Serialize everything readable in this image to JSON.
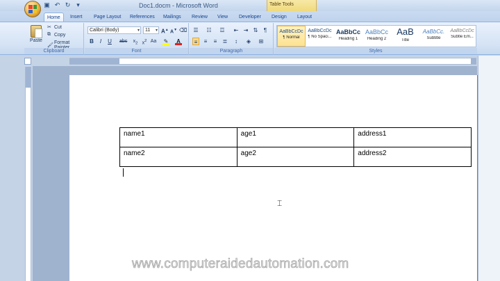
{
  "window": {
    "title": "Doc1.docm - Microsoft Word",
    "contextual_tab_group": "Table Tools"
  },
  "tabs": [
    "Home",
    "Insert",
    "Page Layout",
    "References",
    "Mailings",
    "Review",
    "View",
    "Developer",
    "Design",
    "Layout"
  ],
  "ribbon": {
    "clipboard": {
      "paste": "Paste",
      "cut": "Cut",
      "copy": "Copy",
      "format_painter": "Format Painter",
      "group_label": "Clipboard"
    },
    "font": {
      "family": "Calibri (Body)",
      "size": "11",
      "group_label": "Font"
    },
    "paragraph": {
      "group_label": "Paragraph"
    },
    "styles": {
      "group_label": "Styles",
      "items": [
        {
          "sample": "AaBbCcDc",
          "name": "¶ Normal"
        },
        {
          "sample": "AaBbCcDc",
          "name": "¶ No Spaci..."
        },
        {
          "sample": "AaBbCc",
          "name": "Heading 1"
        },
        {
          "sample": "AaBbCc",
          "name": "Heading 2"
        },
        {
          "sample": "AaB",
          "name": "Title"
        },
        {
          "sample": "AaBbCc.",
          "name": "Subtitle"
        },
        {
          "sample": "AaBbCcDc",
          "name": "Subtle Em..."
        }
      ]
    }
  },
  "document": {
    "table": [
      [
        "name1",
        "age1",
        "address1"
      ],
      [
        "name2",
        "age2",
        "address2"
      ]
    ]
  },
  "watermark": "www.computeraidedautomation.com"
}
